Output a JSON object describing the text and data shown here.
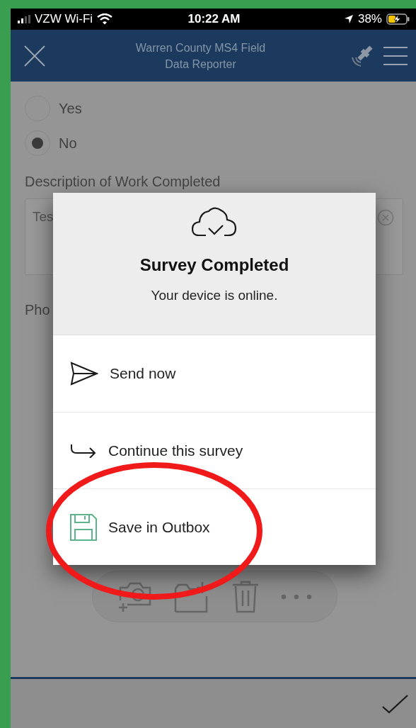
{
  "status_bar": {
    "carrier": "VZW Wi-Fi",
    "time": "10:22 AM",
    "battery": "38%"
  },
  "header": {
    "title": "Warren County MS4 Field Data Reporter"
  },
  "form": {
    "options": [
      {
        "label": "Yes",
        "selected": false
      },
      {
        "label": "No",
        "selected": true
      }
    ],
    "description_label": "Description of Work Completed",
    "description_value": "Tes",
    "photo_label": "Pho"
  },
  "dialog": {
    "title": "Survey Completed",
    "message": "Your device is online.",
    "actions": [
      {
        "kind": "send",
        "label": "Send now"
      },
      {
        "kind": "continue",
        "label": "Continue this survey"
      },
      {
        "kind": "save",
        "label": "Save in Outbox"
      }
    ]
  }
}
